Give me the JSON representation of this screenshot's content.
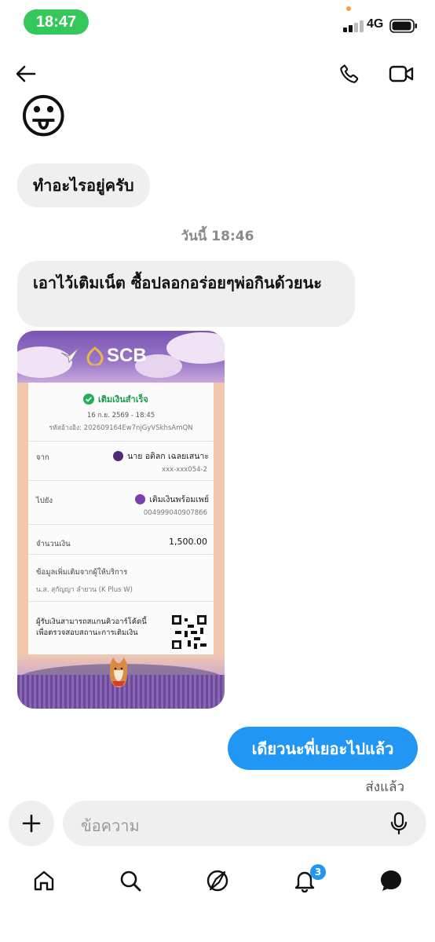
{
  "status_bar": {
    "time": "18:47",
    "network": "4G"
  },
  "header": {
    "contact_name": "",
    "back_icon": "arrow-left-icon",
    "call_icon": "phone-icon",
    "video_icon": "video-camera-icon"
  },
  "messages": {
    "emoji": "😛",
    "msg1": "ทำอะไรอยู่ครับ",
    "timestamp": "วันนี้ 18:46",
    "msg2": "เอาไว้เติมเน็ต ซื้อปลอกอร่อยๆพ่อกินด้วยนะ",
    "outgoing": "เดียวนะพี่เยอะไปแล้ว",
    "sent_status": "ส่งแล้ว"
  },
  "receipt": {
    "bank": "SCB",
    "status": "เติมเงินสำเร็จ",
    "datetime": "16 ก.ย. 2569 - 18:45",
    "ref": "รหัสอ้างอิง: 202609164Ew7njGyVSkhsAmQN",
    "from_label": "จาก",
    "from_name": "นาย อติลก เฉลยเสนาะ",
    "from_account": "xxx-xxx054-2",
    "to_label": "ไปยัง",
    "to_name": "เติมเงินพร้อมเพย์",
    "to_account": "004999040907866",
    "amount_label": "จำนวนเงิน",
    "amount": "1,500.00",
    "extra_label": "ข้อมูลเพิ่มเติมจากผู้ให้บริการ",
    "extra_value": "น.ส. สุกัญญา ลำยวน (K Plus W)",
    "qr_note": "ผู้รับเงินสามารถสแกนคิวอาร์โค้ดนี้เพื่อตรวจสอบสถานะการเติมเงิน"
  },
  "composer": {
    "placeholder": "ข้อความ"
  },
  "bottom_nav": {
    "notification_count": "3"
  },
  "colors": {
    "accent": "#2196f3",
    "status_green": "#34c759",
    "bubble_gray": "#efefef"
  }
}
